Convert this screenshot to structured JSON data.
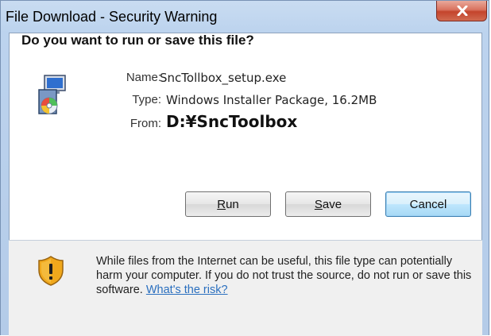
{
  "window": {
    "title": "File Download - Security Warning"
  },
  "dialog": {
    "question": "Do you want to run or save this file?",
    "fields": {
      "name_label": "Name:",
      "name_value": "SncTollbox_setup.exe",
      "type_label": "Type:",
      "type_value": "Windows Installer Package, 16.2MB",
      "from_label": "From:",
      "from_value": "D:¥SncToolbox"
    },
    "buttons": {
      "run": {
        "mnemonic": "R",
        "rest": "un"
      },
      "save": {
        "mnemonic": "S",
        "rest": "ave"
      },
      "cancel": "Cancel"
    },
    "warning": {
      "text": "While files from the Internet can be useful, this file type can potentially harm your computer. If you do not trust the source, do not run or save this software. ",
      "link": "What's the risk?"
    }
  },
  "icons": {
    "close": "close-icon",
    "file": "installer-package-icon",
    "warning": "warning-shield-icon"
  },
  "colors": {
    "link": "#2a6fbf",
    "close_button": "#c4442c",
    "default_button_border": "#3c7fb1",
    "warning_shield": "#f0a81c"
  }
}
